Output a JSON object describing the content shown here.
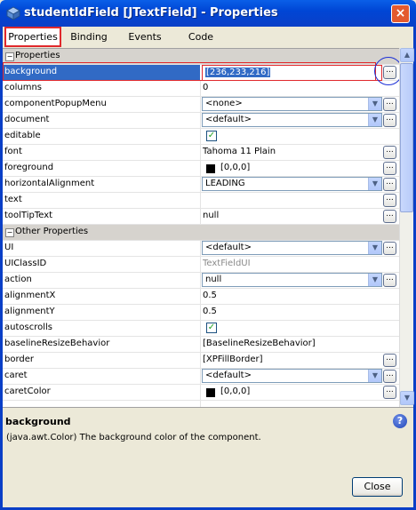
{
  "window": {
    "title": "studentIdField [JTextField] - Properties",
    "close_glyph": "×"
  },
  "tabs": [
    {
      "label": "Properties",
      "active": true
    },
    {
      "label": "Binding",
      "active": false
    },
    {
      "label": "Events",
      "active": false
    },
    {
      "label": "Code",
      "active": false
    }
  ],
  "sections": {
    "properties": "Properties",
    "other": "Other Properties"
  },
  "properties": {
    "background": {
      "name": "background",
      "value": "[236,233,216]"
    },
    "columns": {
      "name": "columns",
      "value": "0"
    },
    "componentPopupMenu": {
      "name": "componentPopupMenu",
      "value": "<none>"
    },
    "document": {
      "name": "document",
      "value": "<default>"
    },
    "editable": {
      "name": "editable",
      "checked": true
    },
    "font": {
      "name": "font",
      "value": "Tahoma 11 Plain"
    },
    "foreground": {
      "name": "foreground",
      "value": "[0,0,0]",
      "color": "#000000"
    },
    "horizontalAlignment": {
      "name": "horizontalAlignment",
      "value": "LEADING"
    },
    "text": {
      "name": "text",
      "value": ""
    },
    "toolTipText": {
      "name": "toolTipText",
      "value": "null"
    }
  },
  "other_properties": {
    "UI": {
      "name": "UI",
      "value": "<default>"
    },
    "UIClassID": {
      "name": "UIClassID",
      "value": "TextFieldUI"
    },
    "action": {
      "name": "action",
      "value": "null"
    },
    "alignmentX": {
      "name": "alignmentX",
      "value": "0.5"
    },
    "alignmentY": {
      "name": "alignmentY",
      "value": "0.5"
    },
    "autoscrolls": {
      "name": "autoscrolls",
      "checked": true
    },
    "baselineResizeBehavior": {
      "name": "baselineResizeBehavior",
      "value": "[BaselineResizeBehavior]"
    },
    "border": {
      "name": "border",
      "value": "[XPFillBorder]"
    },
    "caret": {
      "name": "caret",
      "value": "<default>"
    },
    "caretColor": {
      "name": "caretColor",
      "value": "[0,0,0]",
      "color": "#000000"
    }
  },
  "description": {
    "title": "background",
    "text": "(java.awt.Color)  The background color of the component."
  },
  "buttons": {
    "close": "Close",
    "ellipsis": "...",
    "help": "?"
  },
  "colors": {
    "titlebar": "#0046d5",
    "selection": "#316ac5",
    "highlight_box": "#e0282c",
    "annotation_circle": "#1b2fd6"
  }
}
